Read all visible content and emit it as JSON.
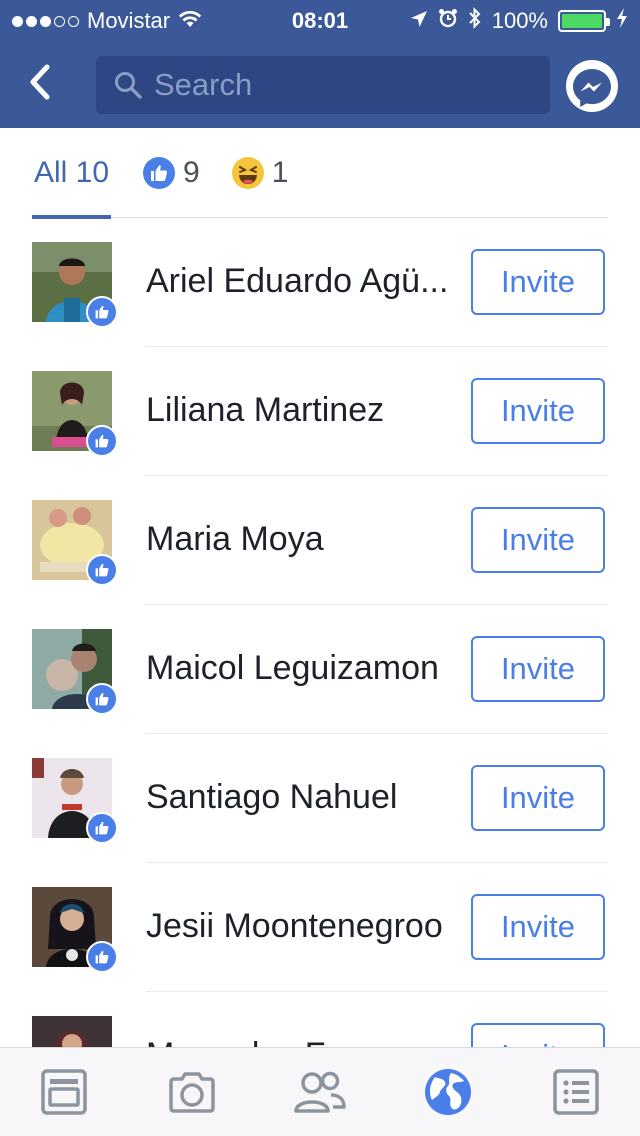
{
  "status_bar": {
    "carrier": "Movistar",
    "time": "08:01",
    "battery": "100%",
    "signal_bars_filled": 3,
    "signal_bars_total": 5
  },
  "nav": {
    "search": {
      "placeholder": "Search",
      "value": ""
    },
    "icons": {
      "back": "back-chevron-icon",
      "search": "search-icon",
      "messenger": "messenger-icon"
    }
  },
  "reaction_tabs": [
    {
      "label": "All 10",
      "active": true
    },
    {
      "reaction": "like",
      "count": "9",
      "active": false
    },
    {
      "reaction": "haha",
      "count": "1",
      "active": false
    }
  ],
  "people": [
    {
      "name": "Ariel Eduardo Agü...",
      "reaction": "like",
      "action": "Invite"
    },
    {
      "name": "Liliana Martinez",
      "reaction": "like",
      "action": "Invite"
    },
    {
      "name": "Maria Moya",
      "reaction": "like",
      "action": "Invite"
    },
    {
      "name": "Maicol Leguizamon",
      "reaction": "like",
      "action": "Invite"
    },
    {
      "name": "Santiago Nahuel",
      "reaction": "like",
      "action": "Invite"
    },
    {
      "name": "Jesii Moontenegroo",
      "reaction": "like",
      "action": "Invite"
    },
    {
      "name": "Mercedes Fe...",
      "reaction": "like",
      "action": "Invite"
    }
  ],
  "tab_bar": {
    "items": [
      {
        "icon": "news-feed-icon",
        "active": false
      },
      {
        "icon": "camera-icon",
        "active": false
      },
      {
        "icon": "friends-icon",
        "active": false
      },
      {
        "icon": "globe-notifications-icon",
        "active": true
      },
      {
        "icon": "menu-list-icon",
        "active": false
      }
    ]
  },
  "colors": {
    "header_blue": "#3b5998",
    "accent_blue": "#4a7fe8",
    "battery_green": "#4cd964",
    "haha_yellow": "#f7c53b"
  }
}
